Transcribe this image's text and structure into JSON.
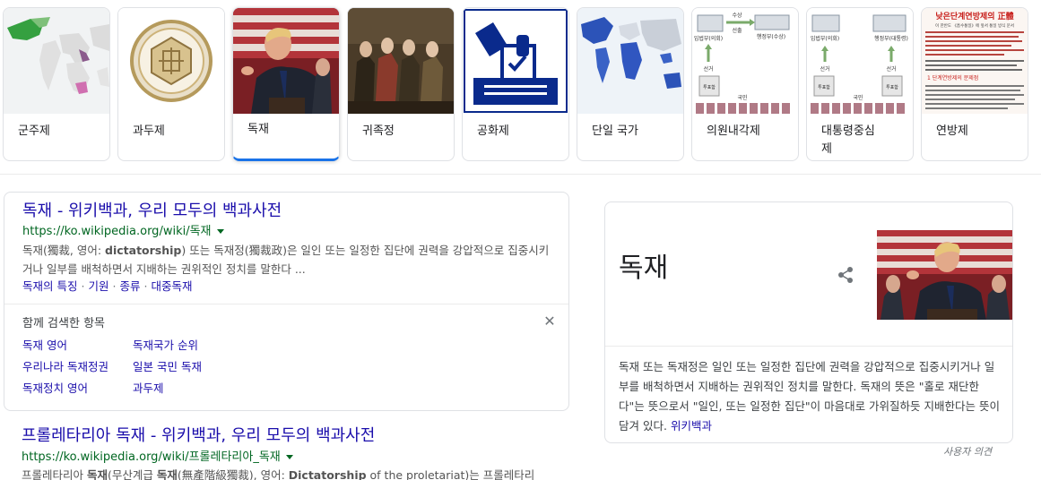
{
  "carousel": {
    "items": [
      {
        "label": "군주제"
      },
      {
        "label": "과두제"
      },
      {
        "label": "독재"
      },
      {
        "label": "귀족정"
      },
      {
        "label": "공화제"
      },
      {
        "label": "단일 국가"
      },
      {
        "label": "의원내각제"
      },
      {
        "label": "대통령중심\n제"
      },
      {
        "label": "연방제"
      }
    ],
    "diagram1": {
      "top_left": "입법부(의회)",
      "top_right": "행정부(수상)",
      "arrow_top": "수상",
      "arrow_bottom": "선출",
      "left_mid": "선거",
      "ballot": "투표함",
      "people": "국민"
    },
    "diagram2": {
      "top_left": "입법부(의회)",
      "top_right": "행정부(대통령)",
      "left_mid": "선거",
      "right_mid": "선거",
      "ballot_left": "투표함",
      "ballot_right": "투표함",
      "people": "국민"
    },
    "poster": {
      "title": "낮은단계연방제의 正體",
      "subtitle": "이 한반도 《흡수통일》에 앞서 통일 방식 문서",
      "footer": "1 단계연방제의 문제점"
    }
  },
  "result1": {
    "title": "독재 - 위키백과, 우리 모두의 백과사전",
    "url": "https://ko.wikipedia.org/wiki/독재",
    "snippet_pre": "독재(獨裁, 영어: ",
    "snippet_bold": "dictatorship",
    "snippet_post": ") 또는 독재정(獨裁政)은 일인 또는 일정한 집단에 권력을 강압적으로 집중시키거나 일부를 배척하면서 지배하는 권위적인 정치를 말한다 ...",
    "sitelinks": [
      "독재의 특징",
      "기원",
      "종류",
      "대중독재"
    ],
    "sitelink_sep": "·"
  },
  "related": {
    "heading": "함께 검색한 항목",
    "close": "✕",
    "links": [
      "독재 영어",
      "독재국가 순위",
      "우리나라 독재정권",
      "일본 국민 독재",
      "독재정치 영어",
      "과두제"
    ]
  },
  "knowledge_panel": {
    "title": "독재",
    "description": "독재 또는 독재정은 일인 또는 일정한 집단에 권력을 강압적으로 집중시키거나 일부를 배척하면서 지배하는 권위적인 정치를 말한다. 독재의 뜻은 \"홀로 재단한다\"는 뜻으로서 \"일인, 또는 일정한 집단\"이 마음대로 가위질하듯 지배한다는 뜻이 담겨 있다.",
    "source_link": "위키백과",
    "feedback": "사용자 의견"
  },
  "result2": {
    "title": "프롤레타리아 독재 - 위키백과, 우리 모두의 백과사전",
    "url": "https://ko.wikipedia.org/wiki/프롤레타리아_독재",
    "snippet_a": "프롤레타리아 ",
    "snippet_b1": "독재",
    "snippet_c": "(무산계급 ",
    "snippet_b2": "독재",
    "snippet_d": "(無產階級獨裁), 영어: ",
    "snippet_b3": "Dictatorship",
    "snippet_e": " of the proletariat)는 프롤레타리"
  },
  "colors": {
    "link": "#1a0dab",
    "url": "#006621",
    "active": "#1a73e8",
    "blue_box": "#0a2a8c"
  }
}
